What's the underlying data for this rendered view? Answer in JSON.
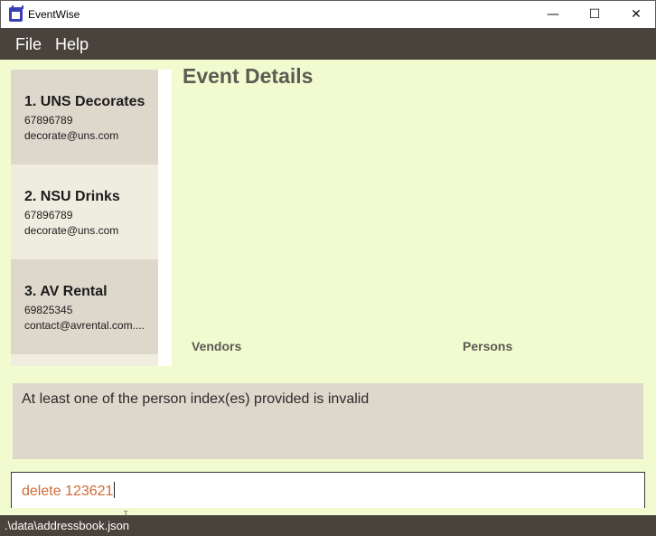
{
  "window": {
    "title": "EventWise",
    "minimize_glyph": "—",
    "maximize_glyph": "☐",
    "close_glyph": "✕"
  },
  "menu": {
    "items": [
      {
        "label": "File"
      },
      {
        "label": "Help"
      }
    ]
  },
  "vendor_list": {
    "items": [
      {
        "name": "1.  UNS Decorates",
        "phone": "67896789",
        "email": "decorate@uns.com"
      },
      {
        "name": "2.  NSU Drinks",
        "phone": "67896789",
        "email": "decorate@uns.com"
      },
      {
        "name": "3.  AV Rental",
        "phone": "69825345",
        "email": "contact@avrental.com...."
      }
    ]
  },
  "event_details": {
    "title": "Event Details",
    "vendors_label": "Vendors",
    "persons_label": "Persons"
  },
  "result_display": {
    "message": "At least one of the person index(es) provided is invalid"
  },
  "command_box": {
    "value": "delete 123621"
  },
  "status_bar": {
    "path": ".\\data\\addressbook.json"
  },
  "colors": {
    "menubar": "#4a433c",
    "main_background": "#f1fbcf",
    "card_dark": "#ded8cc",
    "card_light": "#efeddf",
    "command_text": "#d06a36"
  }
}
